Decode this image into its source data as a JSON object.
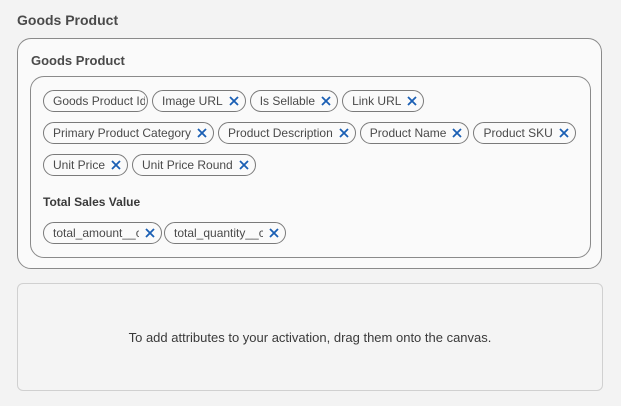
{
  "page": {
    "section_title": "Goods Product"
  },
  "group": {
    "title": "Goods Product",
    "rows": [
      [
        {
          "label": "Goods Product Id",
          "removable": false
        },
        {
          "label": "Image URL",
          "removable": true
        },
        {
          "label": "Is Sellable",
          "removable": true
        },
        {
          "label": "Link URL",
          "removable": true
        }
      ],
      [
        {
          "label": "Primary Product Category",
          "removable": true
        },
        {
          "label": "Product Description",
          "removable": true
        },
        {
          "label": "Product Name",
          "removable": true
        },
        {
          "label": "Product SKU",
          "removable": true
        }
      ],
      [
        {
          "label": "Unit Price",
          "removable": true
        },
        {
          "label": "Unit Price Round",
          "removable": true
        }
      ]
    ],
    "subgroup": {
      "title": "Total Sales Value",
      "chips": [
        {
          "label": "total_amount__c",
          "removable": true
        },
        {
          "label": "total_quantity__c",
          "removable": true
        }
      ]
    }
  },
  "drop_zone": {
    "message": "To add attributes to your activation, drag them onto the canvas."
  },
  "colors": {
    "remove_icon": "#1a5fb4",
    "border": "#8a8a8a"
  }
}
